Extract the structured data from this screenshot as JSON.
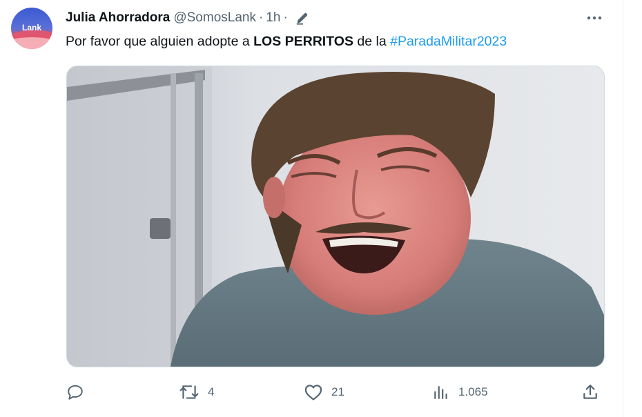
{
  "tweet": {
    "author_name": "Julia Ahorradora",
    "handle": "@SomosLank",
    "separator": "·",
    "time": "1h",
    "time_separator": "·",
    "avatar_text": "Lank",
    "text_parts": {
      "before": "Por favor que alguien adopte a ",
      "bold": "LOS PERRITOS",
      "middle": " de la ",
      "hashtag": "#ParadaMilitar2023"
    },
    "media": {
      "description_icon": "crying-man-photo"
    }
  },
  "actions": {
    "reply": {
      "icon": "reply-icon",
      "count": ""
    },
    "retweet": {
      "icon": "retweet-icon",
      "count": "4"
    },
    "like": {
      "icon": "heart-icon",
      "count": "21"
    },
    "views": {
      "icon": "views-icon",
      "count": "1.065"
    },
    "share": {
      "icon": "share-icon",
      "count": ""
    }
  },
  "colors": {
    "text": "#0f1419",
    "secondary": "#536471",
    "link": "#1d9bf0",
    "border": "#cfd9de"
  }
}
